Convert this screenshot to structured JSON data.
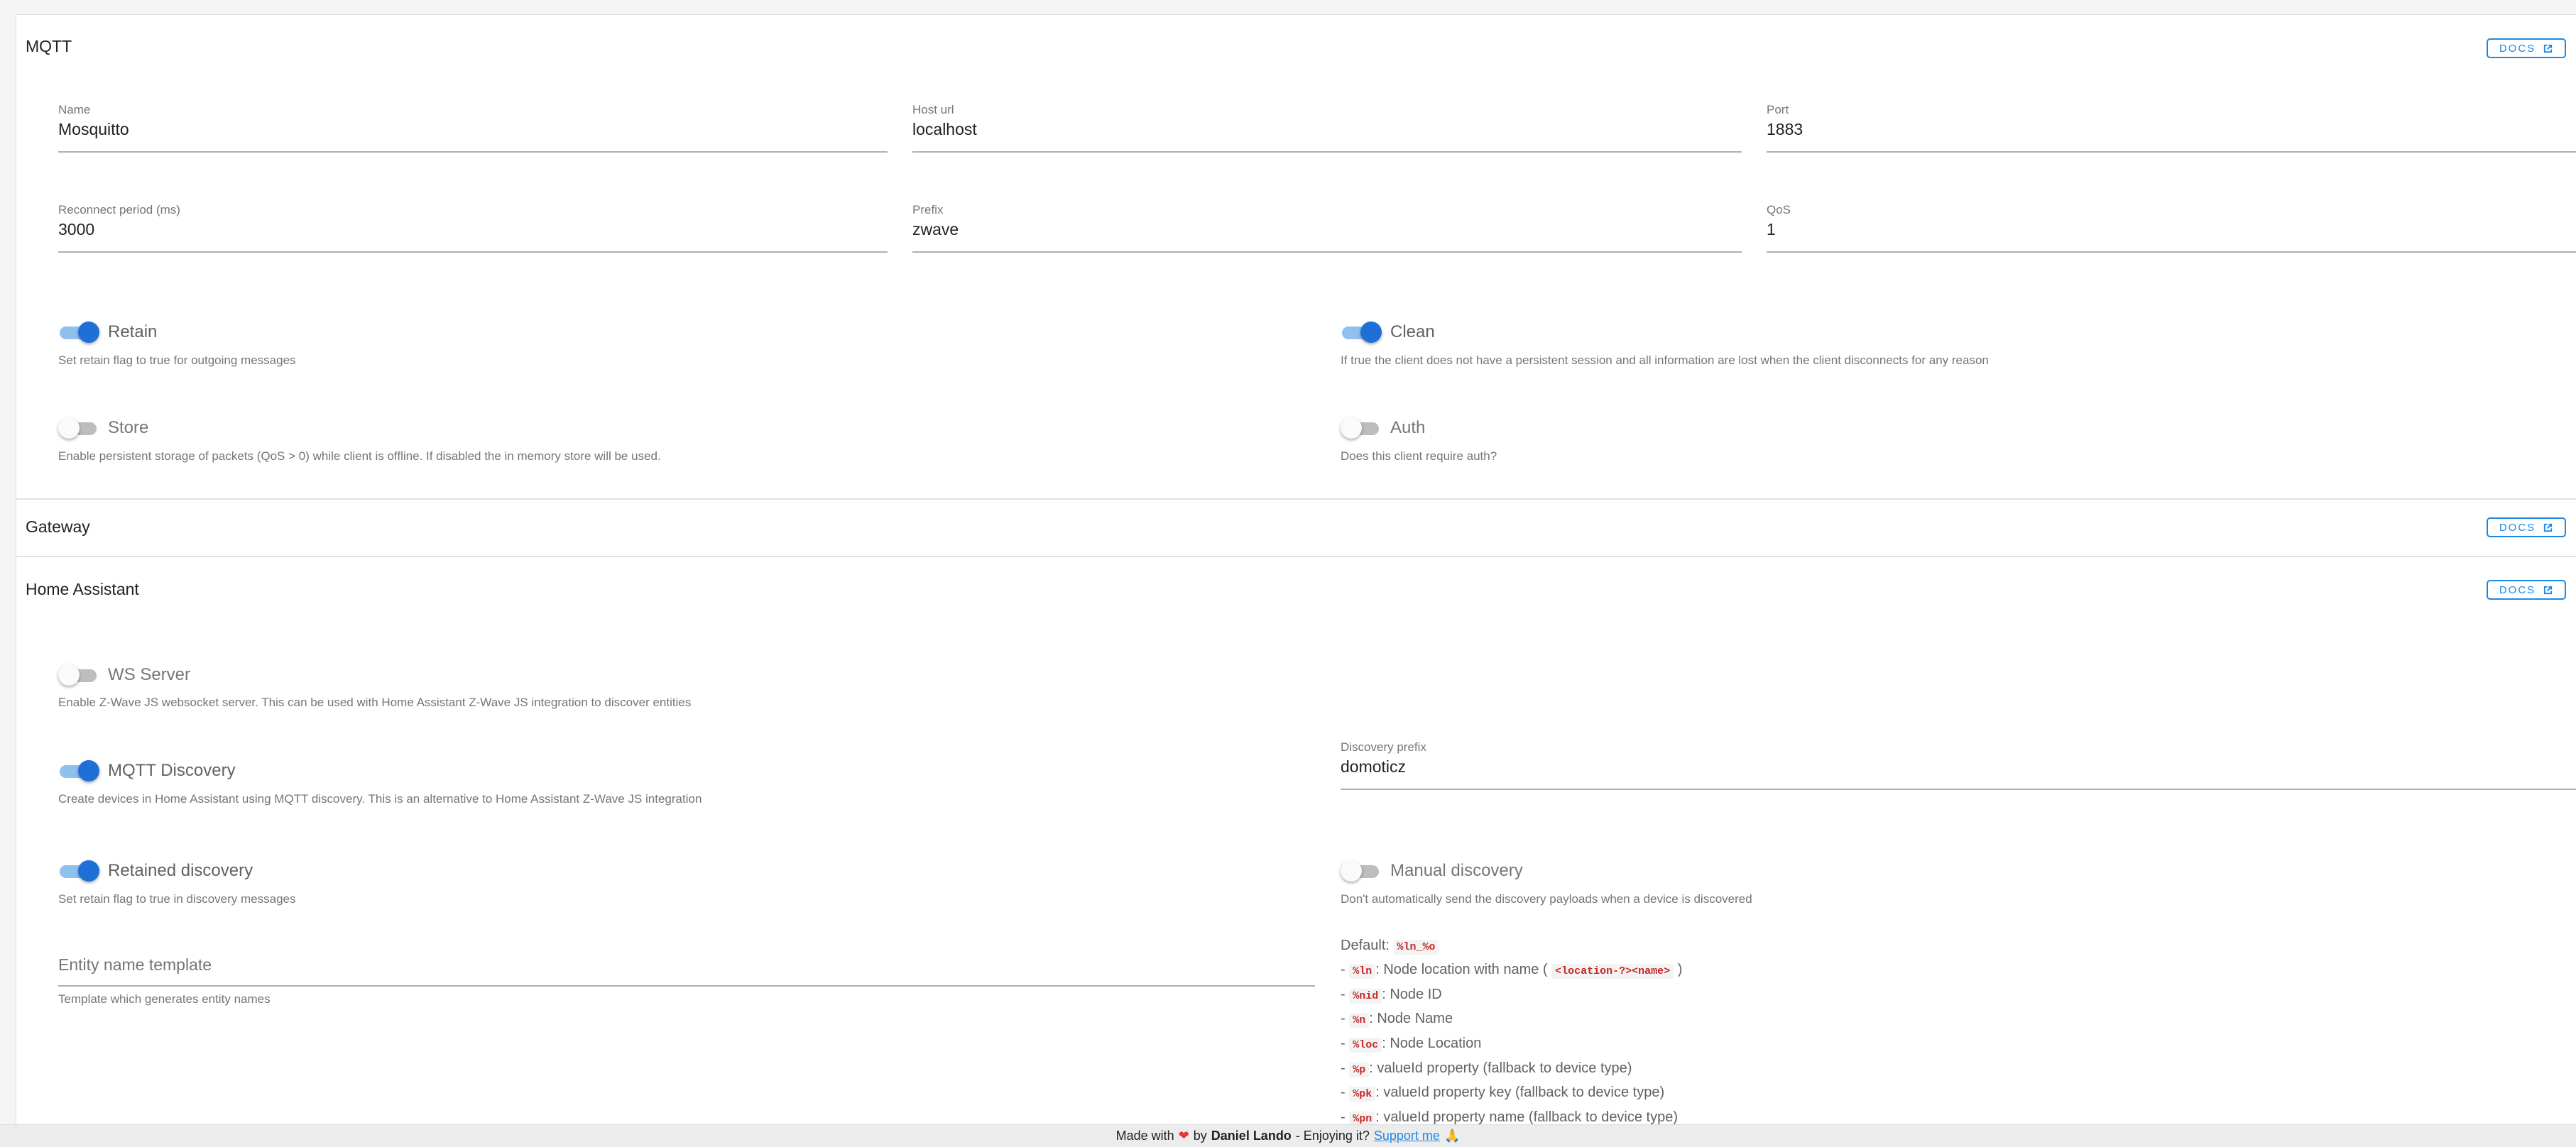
{
  "mqtt": {
    "title": "MQTT",
    "docs_label": "DOCS",
    "fields": [
      {
        "label": "Name",
        "value": "Mosquitto"
      },
      {
        "label": "Host url",
        "value": "localhost"
      },
      {
        "label": "Port",
        "value": "1883"
      },
      {
        "label": "Reconnect period (ms)",
        "value": "3000"
      },
      {
        "label": "Prefix",
        "value": "zwave"
      },
      {
        "label": "QoS",
        "value": "1"
      }
    ],
    "switches": [
      {
        "label": "Retain",
        "on": true,
        "hint": "Set retain flag to true for outgoing messages"
      },
      {
        "label": "Clean",
        "on": true,
        "hint": "If true the client does not have a persistent session and all information are lost when the client disconnects for any reason"
      },
      {
        "label": "Store",
        "on": false,
        "hint": "Enable persistent storage of packets (QoS > 0) while client is offline. If disabled the in memory store will be used."
      },
      {
        "label": "Auth",
        "on": false,
        "hint": "Does this client require auth?"
      }
    ]
  },
  "gateway": {
    "title": "Gateway",
    "docs_label": "DOCS"
  },
  "home_assistant": {
    "title": "Home Assistant",
    "docs_label": "DOCS",
    "switches": [
      {
        "label": "WS Server",
        "on": false,
        "hint": "Enable Z-Wave JS websocket server. This can be used with Home Assistant Z-Wave JS integration to discover entities"
      },
      {
        "label": "MQTT Discovery",
        "on": true,
        "hint": "Create devices in Home Assistant using MQTT discovery. This is an alternative to Home Assistant Z-Wave JS integration"
      },
      {
        "label": "Retained discovery",
        "on": true,
        "hint": "Set retain flag to true in discovery messages"
      },
      {
        "label": "Manual discovery",
        "on": false,
        "hint": "Don't automatically send the discovery payloads when a device is discovered"
      }
    ],
    "discovery_prefix": {
      "label": "Discovery prefix",
      "value": "domoticz"
    },
    "entity_name_template": {
      "placeholder": "Entity name template",
      "hint": "Template which generates entity names"
    },
    "legend": {
      "default_label": "Default:",
      "default_value": "%ln_%o",
      "bullet": "-",
      "items": [
        {
          "code": "%ln",
          "text": ": Node location with name (",
          "code2": "<location-?><name>",
          "text2": ")"
        },
        {
          "code": "%nid",
          "text": ": Node ID"
        },
        {
          "code": "%n",
          "text": ": Node Name"
        },
        {
          "code": "%loc",
          "text": ": Node Location"
        },
        {
          "code": "%p",
          "text": ": valueId property (fallback to device type)"
        },
        {
          "code": "%pk",
          "text": ": valueId property key (fallback to device type)"
        },
        {
          "code": "%pn",
          "text": ": valueId property name (fallback to device type)"
        }
      ]
    }
  },
  "footer": {
    "made_with": "Made with",
    "heart": "❤",
    "by": "by",
    "author": "Daniel Lando",
    "enjoying": "- Enjoying it?",
    "support": "Support me",
    "emoji": "🙏"
  },
  "colors": {
    "accent": "#1e88e5",
    "switch_on": "#1e6fd8",
    "code": "#c62828"
  }
}
